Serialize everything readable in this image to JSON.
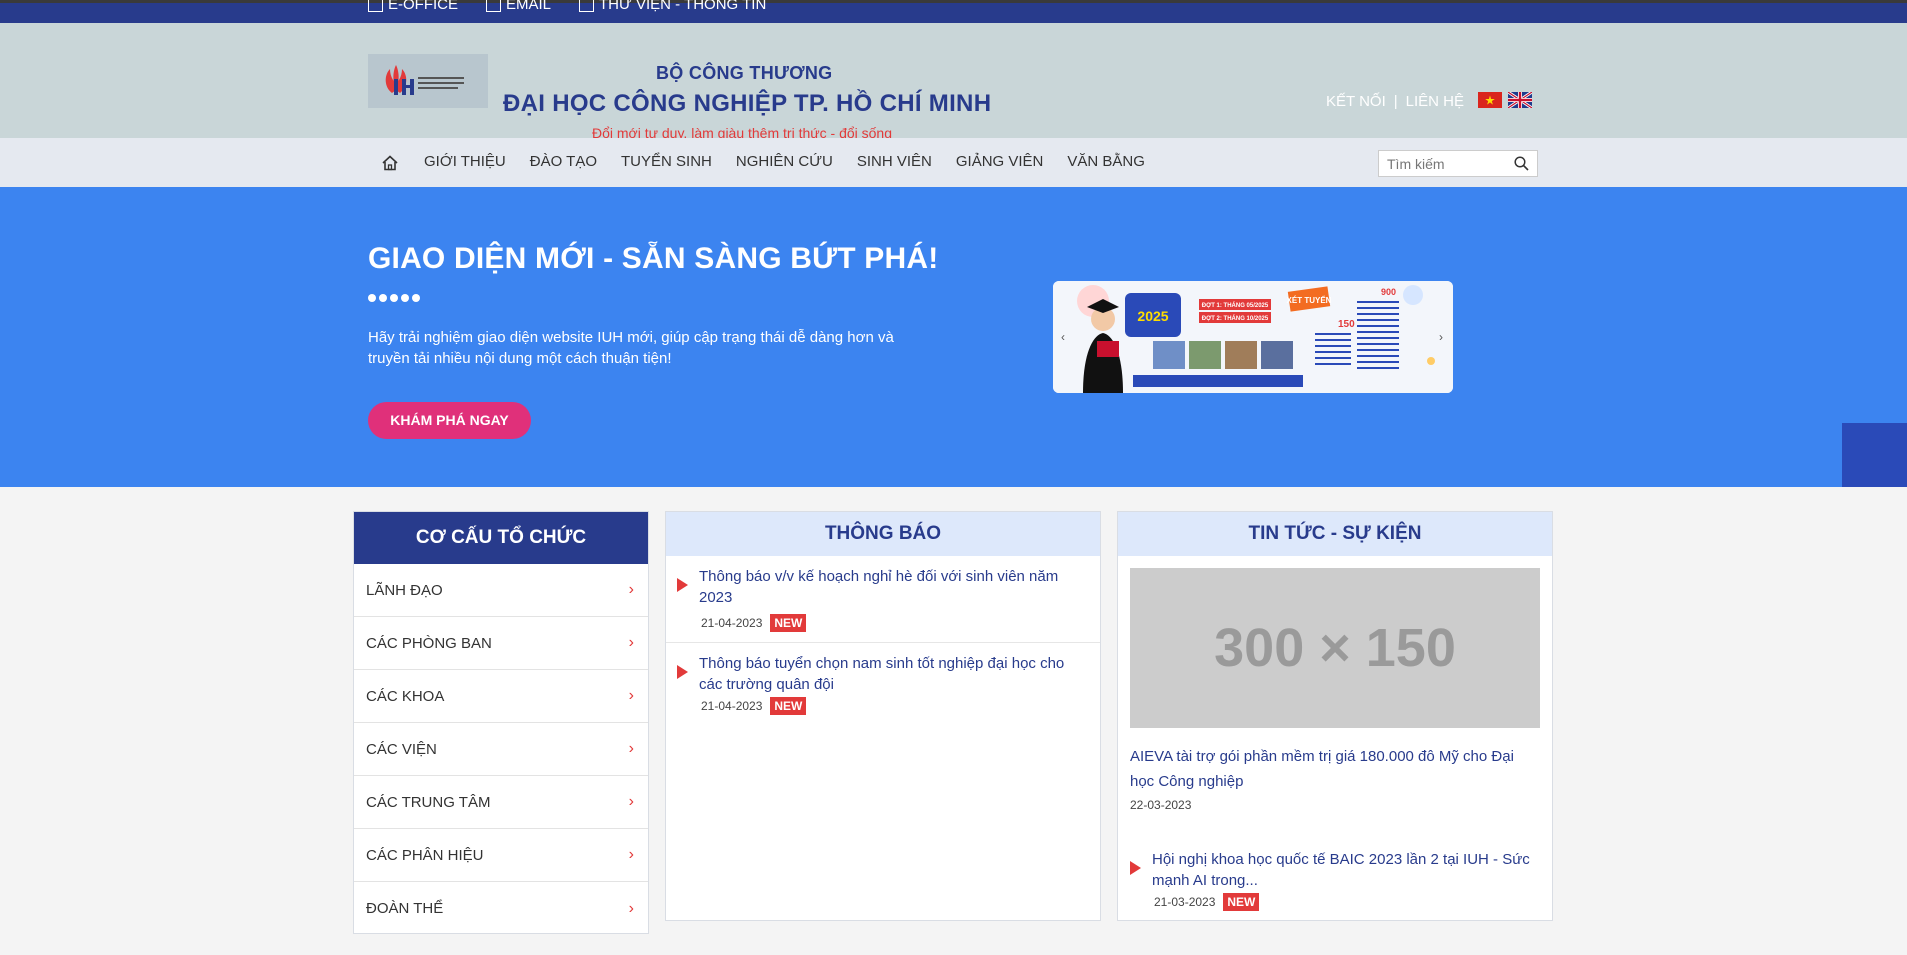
{
  "topbar": {
    "links": [
      "E-OFFICE",
      "EMAIL",
      "THƯ VIỆN - THÔNG TIN"
    ]
  },
  "header": {
    "logo_icon": "iuh-logo-icon",
    "ministry": "BỘ CÔNG THƯƠNG",
    "university": "ĐẠI HỌC CÔNG NGHIỆP TP. HỒ CHÍ MINH",
    "slogan": "Đổi mới tư duy, làm giàu thêm tri thức - đổi sống",
    "connect_label": "KẾT NỐI",
    "separator": "|",
    "contact_label": "LIÊN HỆ",
    "flags": [
      "vietnam-flag-icon",
      "uk-flag-icon"
    ]
  },
  "nav": {
    "home_icon": "home-icon",
    "items": [
      "GIỚI THIỆU",
      "ĐÀO TẠO",
      "TUYỂN SINH",
      "NGHIÊN CỨU",
      "SINH VIÊN",
      "GIẢNG VIÊN",
      "VĂN BẰNG"
    ],
    "search_placeholder": "Tìm kiếm",
    "search_icon": "search-icon"
  },
  "hero": {
    "title": "GIAO DIỆN MỚI - SẴN SÀNG BỨT PHÁ!",
    "description": "Hãy trải nghiệm giao diện website IUH mới, giúp cập trạng thái dễ dàng hơn và truyền tải nhiều nội dung một cách thuận tiện!",
    "button_label": "KHÁM PHÁ NGAY",
    "banner_texts": {
      "year": "2025",
      "round1": "ĐỢT 1: THÁNG 05/2025",
      "round2": "ĐỢT 2: THÁNG 10/2025",
      "tag": "XÉT TUYỂN",
      "quota_main": "900",
      "quota_side": "150"
    },
    "colors": {
      "background": "#3c84f0",
      "button": "#e0307a"
    }
  },
  "org": {
    "title": "CƠ CẤU TỔ CHỨC",
    "items": [
      "LÃNH ĐẠO",
      "CÁC PHÒNG BAN",
      "CÁC KHOA",
      "CÁC VIỆN",
      "CÁC TRUNG TÂM",
      "CÁC PHÂN HIỆU",
      "ĐOÀN THỂ"
    ],
    "chevron": "›"
  },
  "notices": {
    "title": "THÔNG BÁO",
    "items": [
      {
        "title": "Thông báo v/v kế hoạch nghỉ hè đối với sinh viên năm 2023",
        "date": "21-04-2023",
        "badge": "NEW"
      },
      {
        "title": "Thông báo tuyển chọn nam sinh tốt nghiệp đại học cho các trường quân đội",
        "date": "21-04-2023",
        "badge": "NEW"
      }
    ]
  },
  "news": {
    "title": "TIN TỨC - SỰ KIỆN",
    "placeholder": "300 × 150",
    "main": {
      "title": "AIEVA tài trợ gói phần mềm trị giá 180.000 đô Mỹ cho Đại học Công nghiệp",
      "date": "22-03-2023"
    },
    "secondary": {
      "title": "Hội nghị khoa học quốc tế BAIC 2023 lần 2 tại IUH - Sức mạnh AI trong...",
      "date": "21-03-2023",
      "badge": "NEW"
    }
  }
}
